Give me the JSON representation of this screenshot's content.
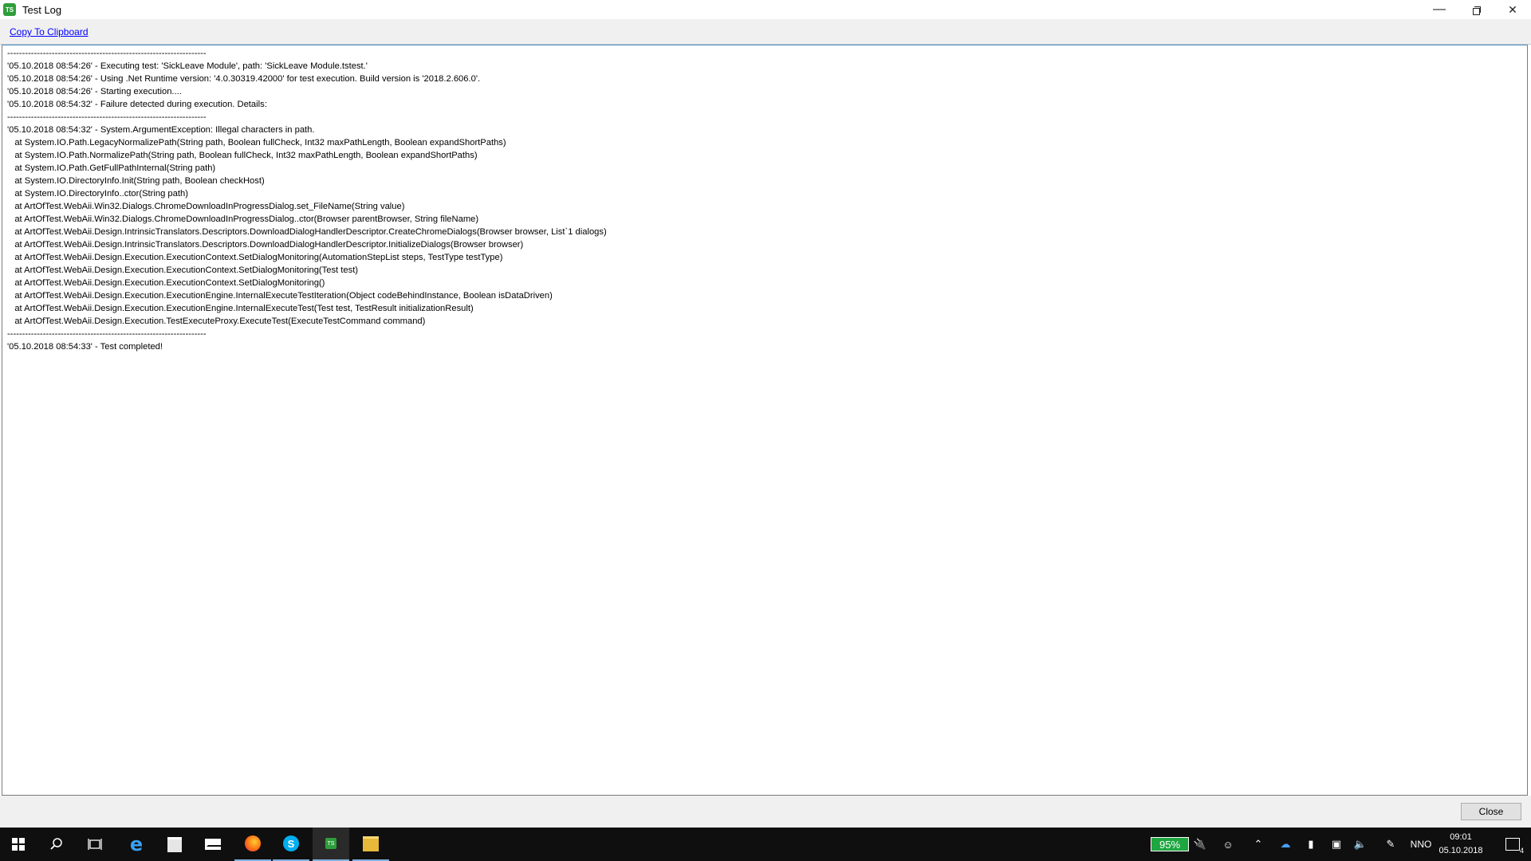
{
  "window": {
    "title": "Test Log",
    "app_icon_text": "TS"
  },
  "toolbar": {
    "copy_label": "Copy To Clipboard"
  },
  "log": {
    "lines": [
      "-------------------------------------------------------------------",
      "'05.10.2018 08:54:26' - Executing test: 'SickLeave Module', path: 'SickLeave Module.tstest.'",
      "'05.10.2018 08:54:26' - Using .Net Runtime version: '4.0.30319.42000' for test execution. Build version is '2018.2.606.0'.",
      "'05.10.2018 08:54:26' - Starting execution....",
      "'05.10.2018 08:54:32' - Failure detected during execution. Details:",
      "-------------------------------------------------------------------",
      "'05.10.2018 08:54:32' - System.ArgumentException: Illegal characters in path.",
      "   at System.IO.Path.LegacyNormalizePath(String path, Boolean fullCheck, Int32 maxPathLength, Boolean expandShortPaths)",
      "   at System.IO.Path.NormalizePath(String path, Boolean fullCheck, Int32 maxPathLength, Boolean expandShortPaths)",
      "   at System.IO.Path.GetFullPathInternal(String path)",
      "   at System.IO.DirectoryInfo.Init(String path, Boolean checkHost)",
      "   at System.IO.DirectoryInfo..ctor(String path)",
      "   at ArtOfTest.WebAii.Win32.Dialogs.ChromeDownloadInProgressDialog.set_FileName(String value)",
      "   at ArtOfTest.WebAii.Win32.Dialogs.ChromeDownloadInProgressDialog..ctor(Browser parentBrowser, String fileName)",
      "   at ArtOfTest.WebAii.Design.IntrinsicTranslators.Descriptors.DownloadDialogHandlerDescriptor.CreateChromeDialogs(Browser browser, List`1 dialogs)",
      "   at ArtOfTest.WebAii.Design.IntrinsicTranslators.Descriptors.DownloadDialogHandlerDescriptor.InitializeDialogs(Browser browser)",
      "   at ArtOfTest.WebAii.Design.Execution.ExecutionContext.SetDialogMonitoring(AutomationStepList steps, TestType testType)",
      "   at ArtOfTest.WebAii.Design.Execution.ExecutionContext.SetDialogMonitoring(Test test)",
      "   at ArtOfTest.WebAii.Design.Execution.ExecutionContext.SetDialogMonitoring()",
      "   at ArtOfTest.WebAii.Design.Execution.ExecutionEngine.InternalExecuteTestIteration(Object codeBehindInstance, Boolean isDataDriven)",
      "   at ArtOfTest.WebAii.Design.Execution.ExecutionEngine.InternalExecuteTest(Test test, TestResult initializationResult)",
      "   at ArtOfTest.WebAii.Design.Execution.TestExecuteProxy.ExecuteTest(ExecuteTestCommand command)",
      "-------------------------------------------------------------------",
      "'05.10.2018 08:54:33' - Test completed!"
    ]
  },
  "footer": {
    "close_label": "Close"
  },
  "taskbar": {
    "battery_percent": "95%",
    "language": "NNO",
    "time": "09:01",
    "date": "05.10.2018",
    "notification_count": "4",
    "accent_color": "#7fb2e0",
    "battery_color": "#1fa640"
  }
}
